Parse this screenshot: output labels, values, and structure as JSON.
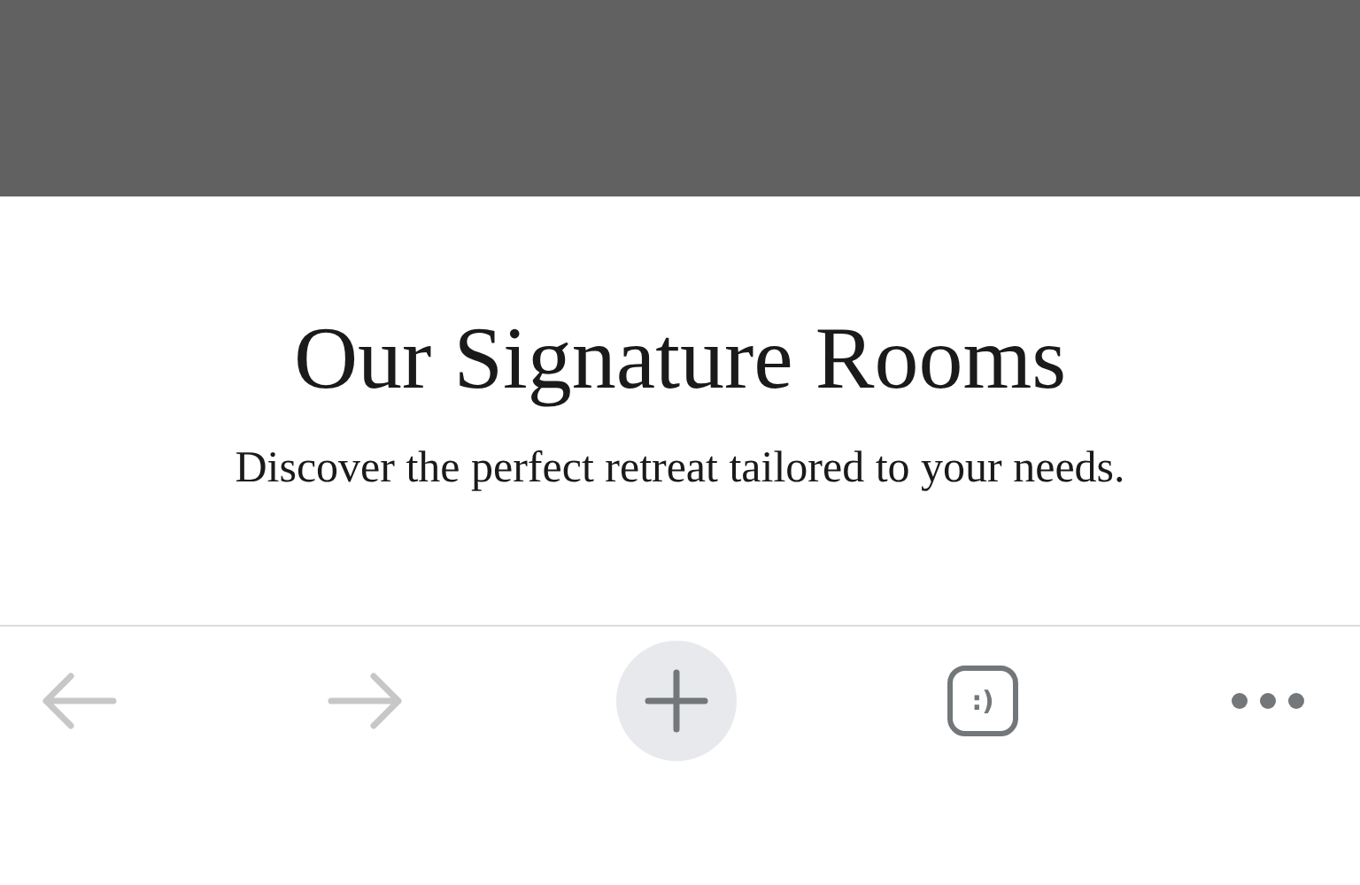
{
  "page": {
    "title": "Our Signature Rooms",
    "subtitle": "Discover the perfect retreat tailored to your needs."
  },
  "toolbar": {
    "items": [
      {
        "kind": "back",
        "disabled": true
      },
      {
        "kind": "forward",
        "disabled": true
      },
      {
        "kind": "new-tab",
        "disabled": false
      },
      {
        "kind": "tabs",
        "label": ":)",
        "disabled": false
      },
      {
        "kind": "more",
        "disabled": false
      }
    ]
  }
}
